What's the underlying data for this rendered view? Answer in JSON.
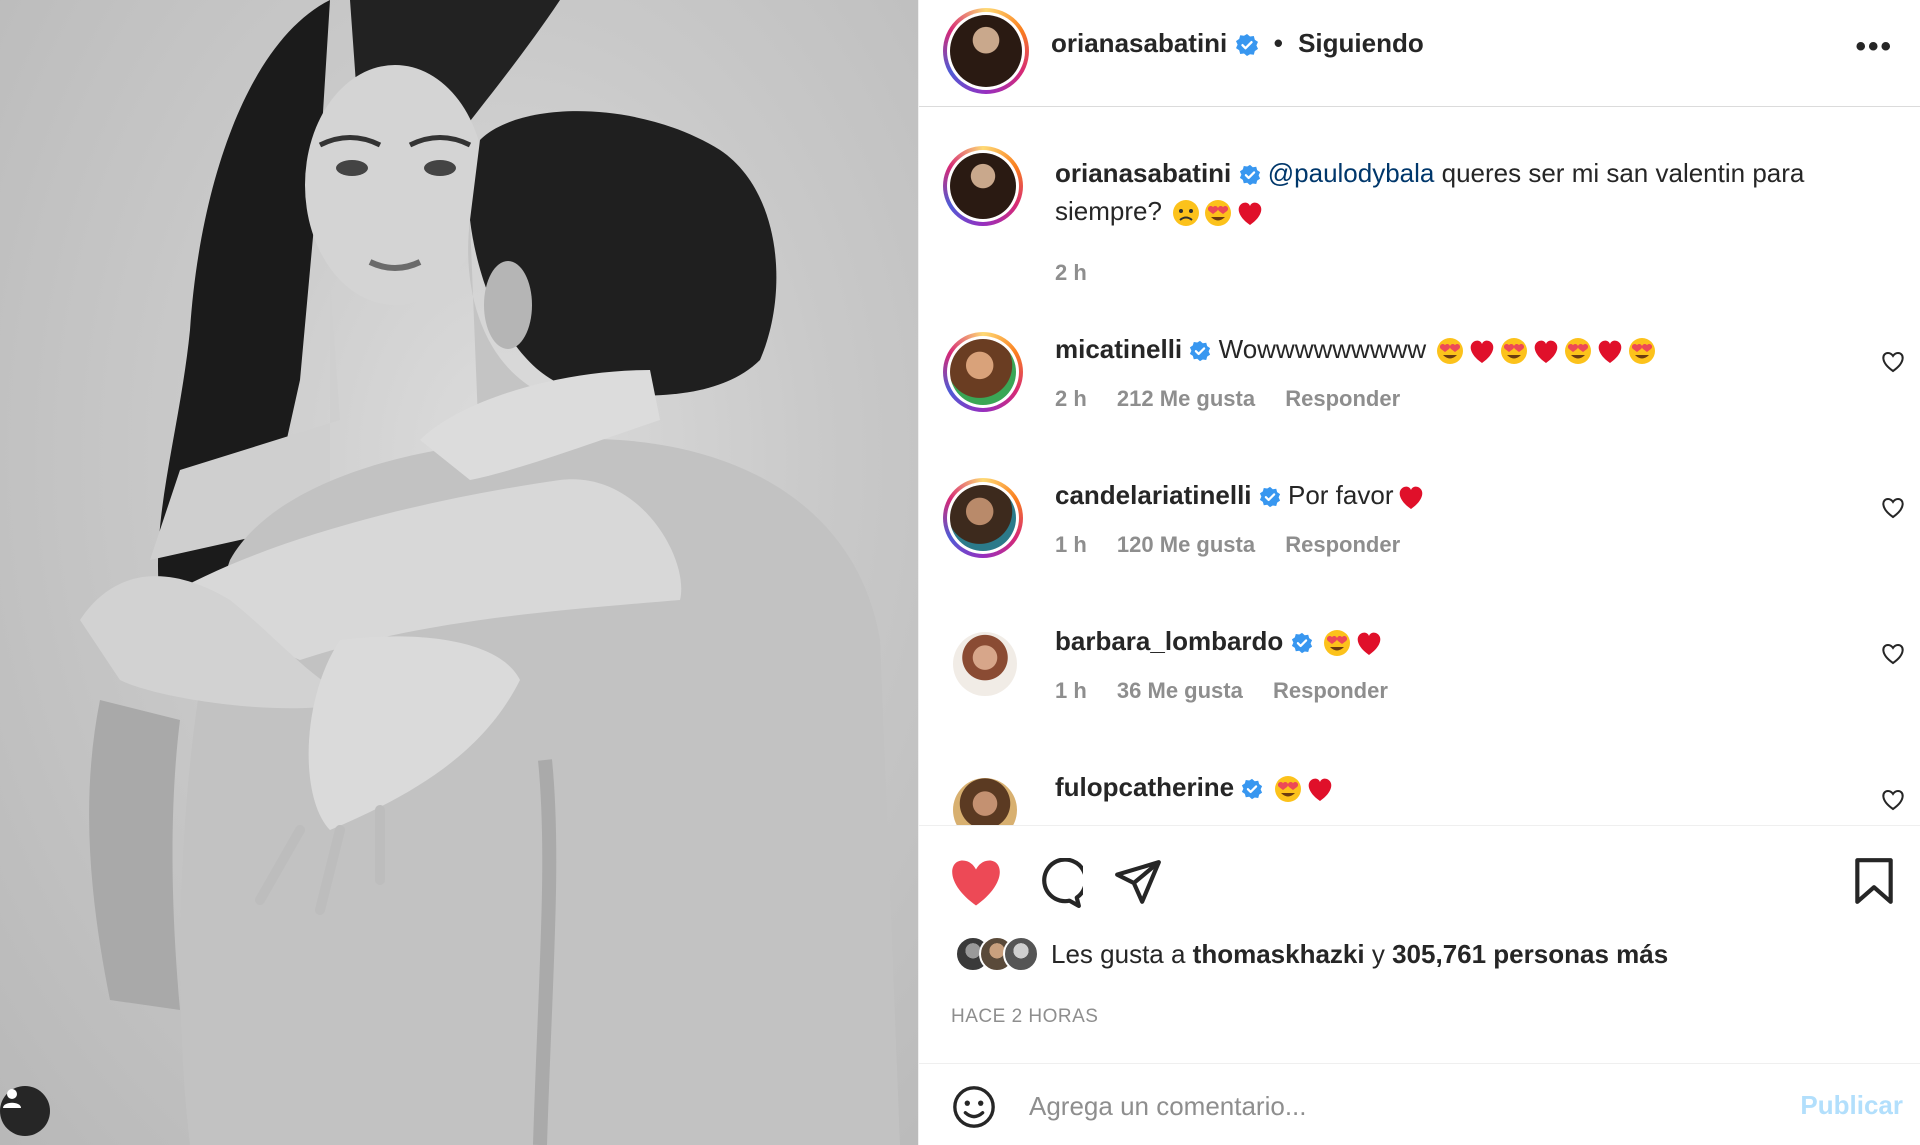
{
  "post": {
    "author": "orianasabatini",
    "separator": "•",
    "follow_state": "Siguiendo",
    "more_icon": "more-horizontal-icon",
    "caption": {
      "author": "orianasabatini",
      "mention": "@paulodybala",
      "text": "queres ser mi san valentin para siempre?",
      "time": "2 h"
    }
  },
  "comments": [
    {
      "user": "micatinelli",
      "text": "Wowwwwwwwww",
      "emojis": [
        "heart-eyes",
        "heart",
        "heart-eyes",
        "heart",
        "heart-eyes",
        "heart",
        "heart-eyes"
      ],
      "time": "2 h",
      "likes": "212 Me gusta",
      "reply": "Responder"
    },
    {
      "user": "candelariatinelli",
      "text": "Por favor",
      "emojis": [
        "heart"
      ],
      "time": "1 h",
      "likes": "120 Me gusta",
      "reply": "Responder"
    },
    {
      "user": "barbara_lombardo",
      "text": "",
      "emojis": [
        "heart-eyes",
        "heart"
      ],
      "time": "1 h",
      "likes": "36 Me gusta",
      "reply": "Responder"
    },
    {
      "user": "fulopcatherine",
      "text": "",
      "emojis": [
        "heart-eyes",
        "heart"
      ],
      "time": "",
      "likes": "",
      "reply": ""
    }
  ],
  "likes": {
    "prefix": "Les gusta a",
    "user": "thomaskhazki",
    "joiner": "y",
    "others": "305,761 personas más"
  },
  "timestamp": "HACE 2 HORAS",
  "composer": {
    "placeholder": "Agrega un comentario...",
    "publish_label": "Publicar"
  },
  "colors": {
    "like_red": "#ed4956",
    "verified_blue": "#3897f0",
    "mention_blue": "#00376b",
    "muted": "#8e8e8e",
    "publish_disabled": "#b2dffc"
  }
}
